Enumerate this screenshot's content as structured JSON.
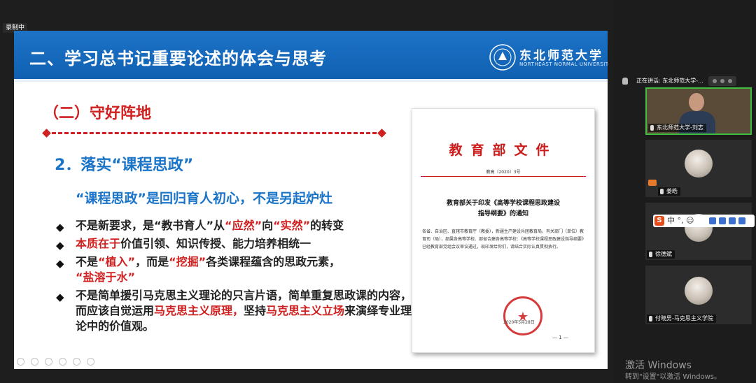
{
  "recording": {
    "label": "录制中"
  },
  "slide": {
    "title": "二、学习总书记重要论述的体会与思考",
    "university_cn": "东北师范大学",
    "university_en": "NORTHEAST NORMAL UNIVERSITY",
    "section_title": "（二）守好阵地",
    "subsection_title": "2．落实“课程思政”",
    "quote": "“课程思政”是回归育人初心，不是另起炉灶",
    "bullets": [
      {
        "t1": "不是新要求，是“教书育人”从",
        "r1": "“应然”",
        "t2": "向",
        "r2": "“实然”",
        "t3": "的转变"
      },
      {
        "r1": "本质在于",
        "t1": "价值引领、知识传授、能力培养相统一"
      },
      {
        "t1": "不是",
        "r1": "“植入”",
        "t2": "，而是",
        "r2": "“挖掘”",
        "t3": "各类课程蕴含的思政元素，",
        "r3": "“盐溶于水”"
      },
      {
        "t1": "不是简单援引马克思主义理论的只言片语，简单重复思政课的内容，而应该自觉运用",
        "r1": "马克思主义原理，",
        "t2": "坚持",
        "r2": "马克思主义立场",
        "t3": "来演绎专业理论中的价值观。"
      }
    ],
    "document": {
      "header": "教育部文件",
      "number": "教高〔2020〕3号",
      "title_line1": "教育部关于印发《高等学校课程思政建设",
      "title_line2": "指导纲要》的通知",
      "body": "各省、自治区、直辖市教育厅（教委），新疆生产建设兵团教育局，有关部门（单位）教育司（局），部属各高等学校、部省合建各高等学校：《高等学校课程思政建设指导纲要》已经教育部党组会议审议通过，现印发给你们，请结合实际认真贯彻执行。",
      "date": "2020年5月28日",
      "page": "— 1 —"
    }
  },
  "sidebar": {
    "speaking": "正在讲话: 东北师范大学-...",
    "participants": [
      {
        "name": "东北师范大学-刘志"
      },
      {
        "name": "姜皓"
      },
      {
        "name": "徐德斌"
      },
      {
        "name": "付晓男-马克思主义学院"
      }
    ]
  },
  "ime": {
    "text": "中 °, ☺"
  },
  "watermark": {
    "line1": "激活 Windows",
    "line2": "转到\"设置\"以激活 Windows。"
  },
  "colors": {
    "accent_blue": "#1a74c8",
    "accent_red": "#d12020",
    "active_border": "#3fbf3f"
  }
}
